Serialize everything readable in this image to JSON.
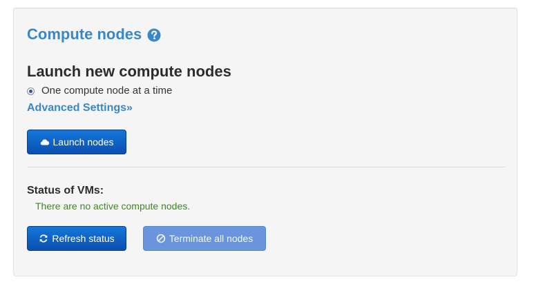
{
  "panel": {
    "title": "Compute nodes",
    "help_icon": "question-circle-icon",
    "launch": {
      "heading": "Launch new compute nodes",
      "radio_label": "One compute node at a time",
      "radio_selected": true,
      "advanced_link": "Advanced Settings»",
      "launch_button": {
        "label": "Launch nodes",
        "icon": "cloud-icon"
      }
    },
    "status": {
      "heading": "Status of VMs:",
      "message": "There are no active compute nodes.",
      "refresh_button": {
        "label": "Refresh status",
        "icon": "refresh-icon"
      },
      "terminate_button": {
        "label": "Terminate all nodes",
        "icon": "ban-icon",
        "disabled": true
      }
    }
  },
  "colors": {
    "title_blue": "#3a87c8",
    "button_primary": "#0e62c5",
    "button_disabled": "#6a95dc",
    "status_green": "#3a8a1e",
    "panel_bg": "#f5f5f5"
  }
}
